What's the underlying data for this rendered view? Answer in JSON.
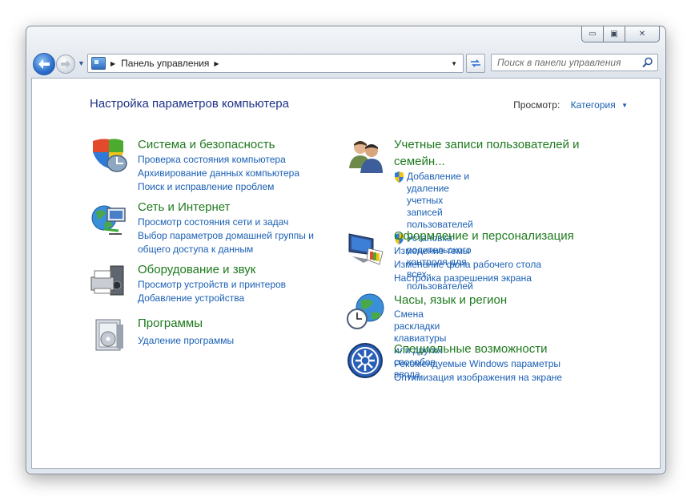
{
  "window": {
    "minimize_glyph": "▭",
    "maximize_glyph": "▣",
    "close_glyph": "✕"
  },
  "navigation": {
    "back_icon": "arrow-left-icon",
    "address_path": "Панель управления",
    "search_placeholder": "Поиск в панели управления"
  },
  "page": {
    "title": "Настройка параметров компьютера",
    "view_label": "Просмотр:",
    "view_value": "Категория"
  },
  "left_categories": [
    {
      "title": "Система и безопасность",
      "links": [
        "Проверка состояния компьютера",
        "Архивирование данных компьютера",
        "Поиск и исправление проблем"
      ]
    },
    {
      "title": "Сеть и Интернет",
      "links": [
        "Просмотр состояния сети и задач",
        "Выбор параметров домашней группы и",
        "общего доступа к данным"
      ]
    },
    {
      "title": "Оборудование и звук",
      "links": [
        "Просмотр устройств и принтеров",
        "Добавление устройства"
      ]
    },
    {
      "title": "Программы",
      "links": [
        "Удаление программы"
      ]
    }
  ],
  "right_categories": [
    {
      "title_line1": "Учетные записи пользователей и",
      "title_line2": "семейн...",
      "links": [
        {
          "line1": "Добавление и удаление учетных записей",
          "line2": "пользователей"
        },
        {
          "line1": "Установка родительского контроля для",
          "line2": "всех пользователей"
        }
      ]
    },
    {
      "title": "Оформление и персонализация",
      "links": [
        "Изменение темы",
        "Изменение фона рабочего стола",
        "Настройка разрешения экрана"
      ]
    },
    {
      "title": "Часы, язык и регион",
      "links": [
        "Смена раскладки клавиатуры или других",
        "способов ввода"
      ]
    },
    {
      "title": "Специальные возможности",
      "links": [
        "Рекомендуемые Windows параметры",
        "Оптимизация изображения на экране"
      ]
    }
  ],
  "colors": {
    "category_title": "#1e7a1e",
    "link": "#1a5fb4",
    "header": "#1e3287"
  }
}
